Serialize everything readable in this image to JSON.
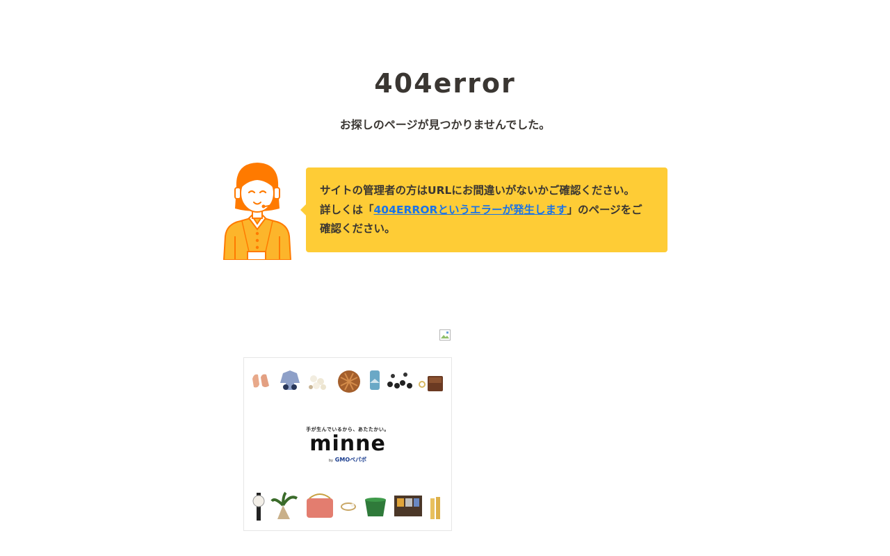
{
  "error": {
    "title": "404error",
    "subtitle": "お探しのページが見つかりませんでした。"
  },
  "message": {
    "line1": "サイトの管理者の方はURLにお間違いがないかご確認ください。",
    "line2_prefix": "詳しくは「",
    "link_text": "404ERRORというエラーが発生します",
    "line2_suffix": "」のページをご",
    "line3": "確認ください。"
  },
  "ad": {
    "tagline": "手が生んでいるから、あたたかい。",
    "logo": "minne",
    "by_prefix": "by",
    "by_brand": "GMOペパボ"
  },
  "colors": {
    "bubble": "#fecc36",
    "link": "#1a73e8",
    "character_orange": "#ff7a00",
    "character_shirt": "#fcb52b"
  }
}
